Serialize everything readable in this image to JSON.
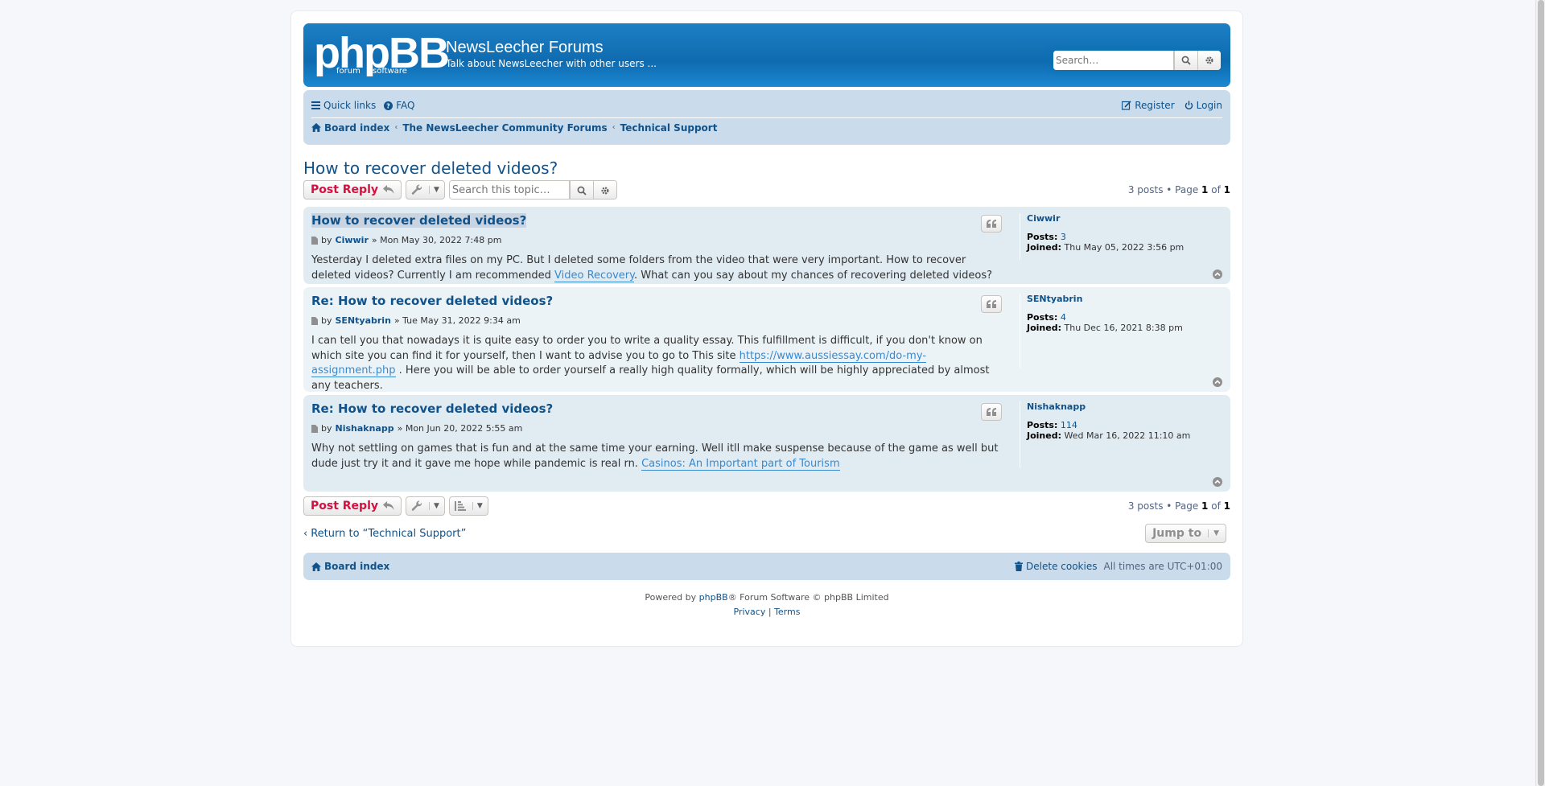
{
  "header": {
    "logo_big": "phpBB",
    "logo_forum": "forum",
    "logo_software": "software",
    "site_title": "NewsLeecher Forums",
    "site_description": "Talk about NewsLeecher with other users ...",
    "search_placeholder": "Search…"
  },
  "nav": {
    "quick_links": "Quick links",
    "faq": "FAQ",
    "register": "Register",
    "login": "Login",
    "breadcrumbs": [
      "Board index",
      "The NewsLeecher Community Forums",
      "Technical Support"
    ]
  },
  "topic": {
    "title": "How to recover deleted videos?",
    "search_placeholder": "Search this topic…",
    "post_reply": "Post Reply",
    "pagination": {
      "prefix": "3 posts • Page",
      "page": "1",
      "of": "of",
      "total": "1"
    }
  },
  "posts": [
    {
      "title": "How to recover deleted videos?",
      "by": "by",
      "author": "Ciwwir",
      "date": "» Mon May 30, 2022 7:48 pm",
      "text1": "Yesterday I deleted extra files on my PC. But I deleted some folders from the video that were very important. How to recover deleted videos? Currently I am recommended ",
      "link": "Video Recovery",
      "text2": ". What can you say about my chances of recovering deleted videos?",
      "profile": {
        "name": "Ciwwir",
        "posts_label": "Posts:",
        "posts": "3",
        "joined_label": "Joined:",
        "joined": "Thu May 05, 2022 3:56 pm"
      }
    },
    {
      "title": "Re: How to recover deleted videos?",
      "by": "by",
      "author": "SENtyabrin",
      "date": "» Tue May 31, 2022 9:34 am",
      "text1": "I can tell you that nowadays it is quite easy to order you to write a quality essay. This fulfillment is difficult, if you don't know on which site you can find it for yourself, then I want to advise you to go to This site ",
      "link": "https://www.aussiessay.com/do-my-assignment.php",
      "text2": " . Here you will be able to order yourself a really high quality formally, which will be highly appreciated by almost any teachers.",
      "profile": {
        "name": "SENtyabrin",
        "posts_label": "Posts:",
        "posts": "4",
        "joined_label": "Joined:",
        "joined": "Thu Dec 16, 2021 8:38 pm"
      }
    },
    {
      "title": "Re: How to recover deleted videos?",
      "by": "by",
      "author": "Nishaknapp",
      "date": "» Mon Jun 20, 2022 5:55 am",
      "text1": "Why not settling on games that is fun and at the same time your earning. Well itll make suspense because of the game as well but dude just try it and it gave me hope while pandemic is real rn. ",
      "link": "Casinos: An Important part of Tourism",
      "text2": "",
      "profile": {
        "name": "Nishaknapp",
        "posts_label": "Posts:",
        "posts": "114",
        "joined_label": "Joined:",
        "joined": "Wed Mar 16, 2022 11:10 am"
      }
    }
  ],
  "bottom": {
    "return_link": "Return to “Technical Support”",
    "jump_to": "Jump to"
  },
  "footer": {
    "board_index": "Board index",
    "delete_cookies": "Delete cookies",
    "times": "All times are UTC+01:00",
    "powered_prefix": "Powered by",
    "phpbb": "phpBB",
    "powered_suffix": "® Forum Software © phpBB Limited",
    "privacy": "Privacy",
    "sep": "|",
    "terms": "Terms"
  },
  "colors": {
    "brand": "#105289",
    "reply": "#d31141",
    "header": "#0f6bb0",
    "navbar": "#cadceb"
  }
}
